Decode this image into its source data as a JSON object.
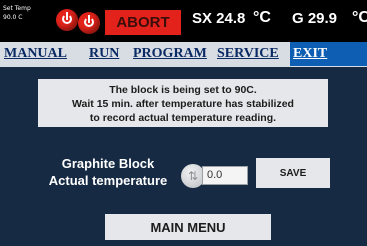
{
  "status_bar": {
    "set_temp_label": "Set Temp",
    "set_temp_value": "90.0   C",
    "abort_label": "ABORT",
    "sx_reading": "SX 24.8",
    "g_reading": "G 29.9",
    "unit": "°C"
  },
  "nav": {
    "items": [
      {
        "label": "MANUAL"
      },
      {
        "label": "RUN"
      },
      {
        "label": "PROGRAM"
      },
      {
        "label": "SERVICE"
      },
      {
        "label": "EXIT"
      }
    ]
  },
  "message": {
    "line1": "The block is being set to 90C.",
    "line2": "Wait 15 min. after temperature has stabilized",
    "line3": "to record actual temperature reading."
  },
  "form": {
    "label_line1": "Graphite Block",
    "label_line2": "Actual temperature",
    "value": "0.0",
    "save_label": "SAVE"
  },
  "footer": {
    "main_menu_label": "MAIN MENU"
  },
  "colors": {
    "abort_red": "#e3231b",
    "nav_active": "#0e5fb3",
    "content_bg": "#162a43"
  },
  "icons": [
    "power-icon",
    "power-icon",
    "spinner-icon"
  ]
}
